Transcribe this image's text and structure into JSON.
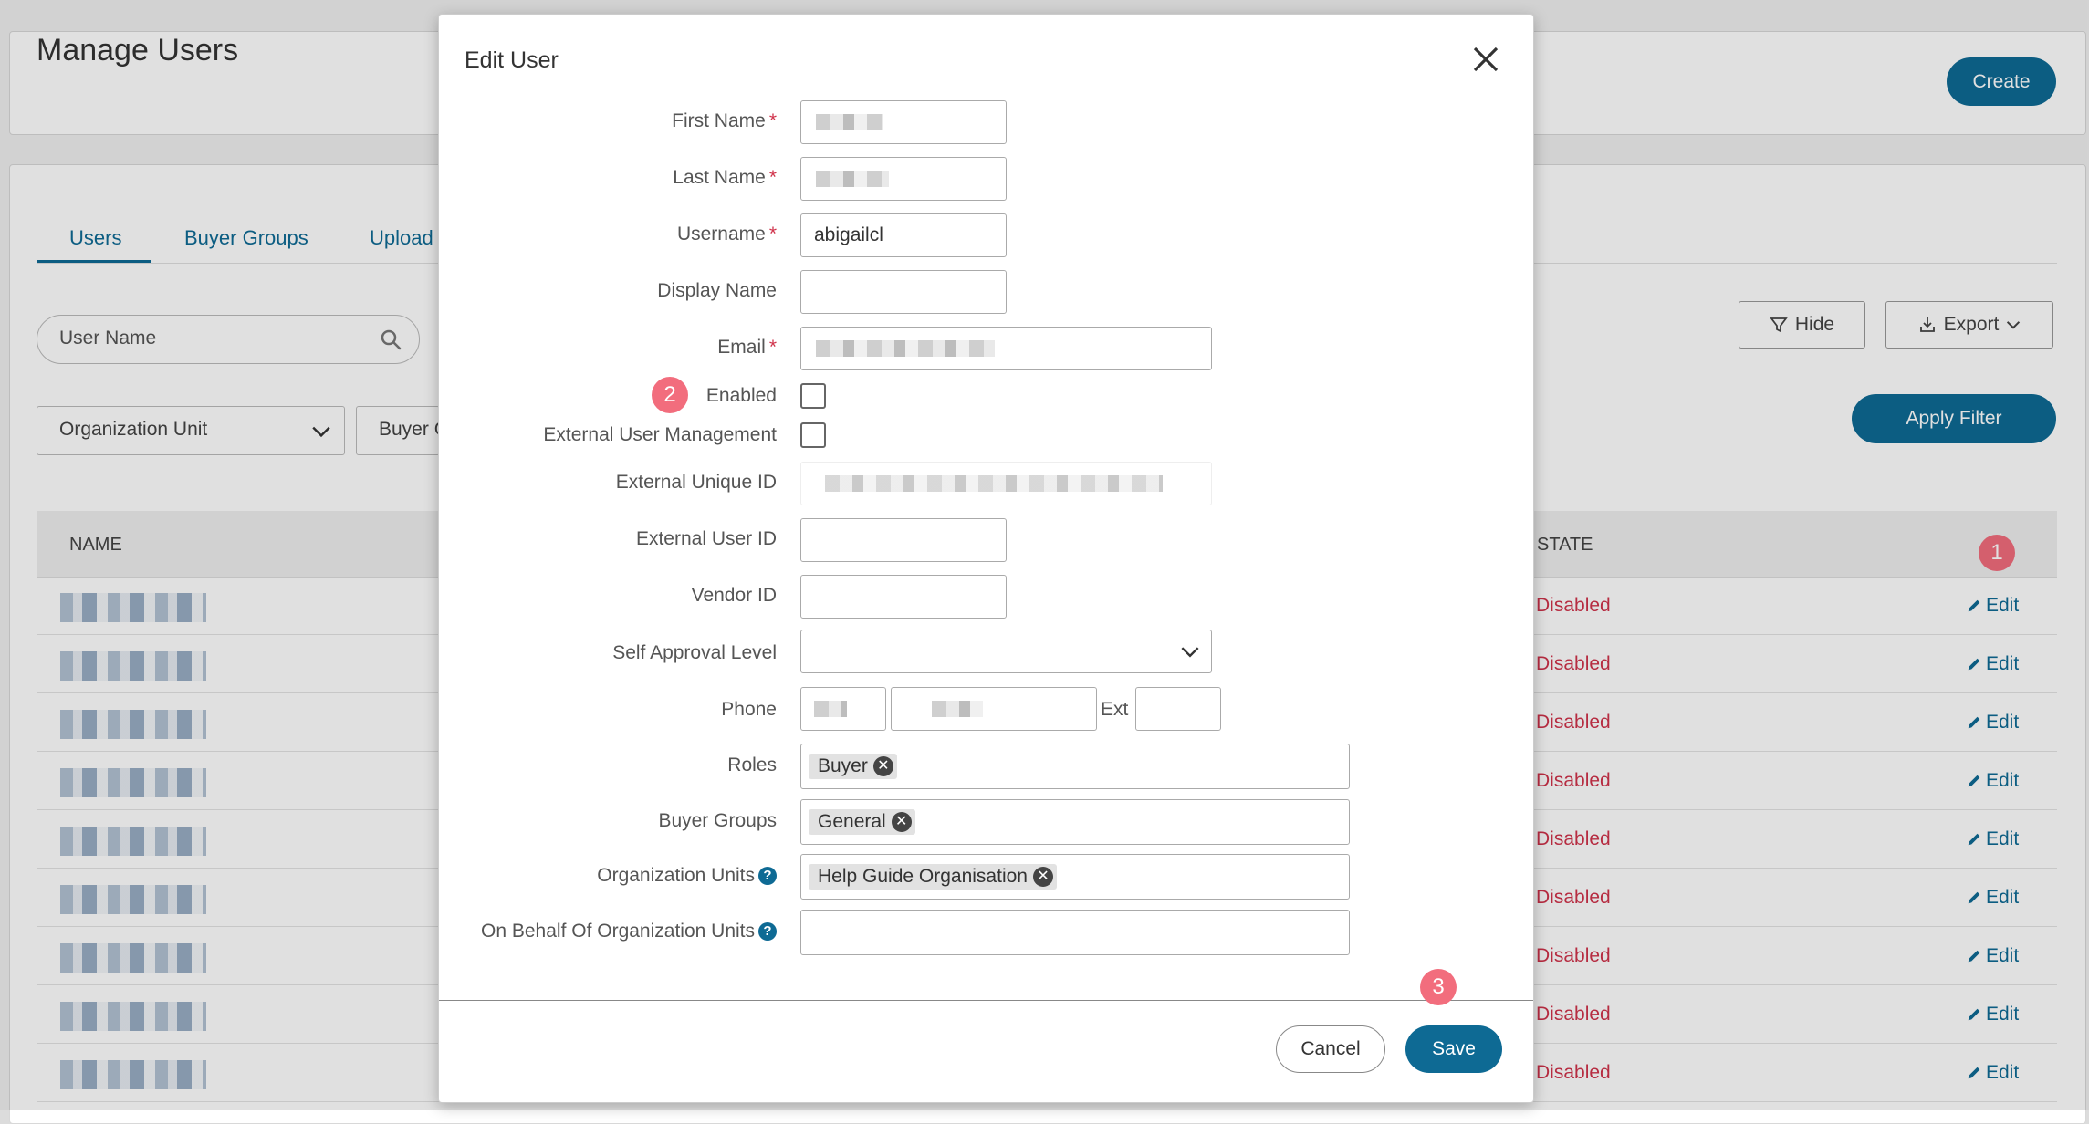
{
  "page": {
    "title": "Manage Users",
    "create_label": "Create",
    "tabs": [
      "Users",
      "Buyer Groups",
      "Upload"
    ],
    "search_placeholder": "User Name",
    "filters": [
      "Organization Unit",
      "Buyer G"
    ],
    "hide_label": "Hide",
    "export_label": "Export",
    "apply_filter_label": "Apply Filter",
    "table": {
      "columns": [
        "NAME",
        "STATE"
      ],
      "rows": [
        {
          "state": "Disabled",
          "action": "Edit"
        },
        {
          "state": "Disabled",
          "action": "Edit"
        },
        {
          "state": "Disabled",
          "action": "Edit"
        },
        {
          "state": "Disabled",
          "action": "Edit"
        },
        {
          "state": "Disabled",
          "action": "Edit"
        },
        {
          "state": "Disabled",
          "action": "Edit"
        },
        {
          "state": "Disabled",
          "action": "Edit"
        },
        {
          "state": "Disabled",
          "action": "Edit"
        },
        {
          "state": "Disabled",
          "action": "Edit"
        }
      ]
    }
  },
  "markers": [
    "1",
    "2",
    "3"
  ],
  "modal": {
    "title": "Edit User",
    "fields": {
      "first_name": "First Name",
      "last_name": "Last Name",
      "username": "Username",
      "username_value": "abigailcl",
      "display_name": "Display Name",
      "email": "Email",
      "enabled": "Enabled",
      "external_user_management": "External User Management",
      "external_unique_id": "External Unique ID",
      "external_user_id": "External User ID",
      "vendor_id": "Vendor ID",
      "self_approval_level": "Self Approval Level",
      "phone": "Phone",
      "ext": "Ext",
      "roles": "Roles",
      "buyer_groups": "Buyer Groups",
      "organization_units": "Organization Units",
      "on_behalf_org_units": "On Behalf Of Organization Units"
    },
    "required_mark": "*",
    "roles_chips": [
      "Buyer"
    ],
    "buyer_group_chips": [
      "General"
    ],
    "org_unit_chips": [
      "Help Guide Organisation"
    ],
    "cancel_label": "Cancel",
    "save_label": "Save"
  },
  "colors": {
    "primary": "#0e6a94",
    "disabled_state": "#d0334b",
    "marker": "#f26d7d"
  }
}
